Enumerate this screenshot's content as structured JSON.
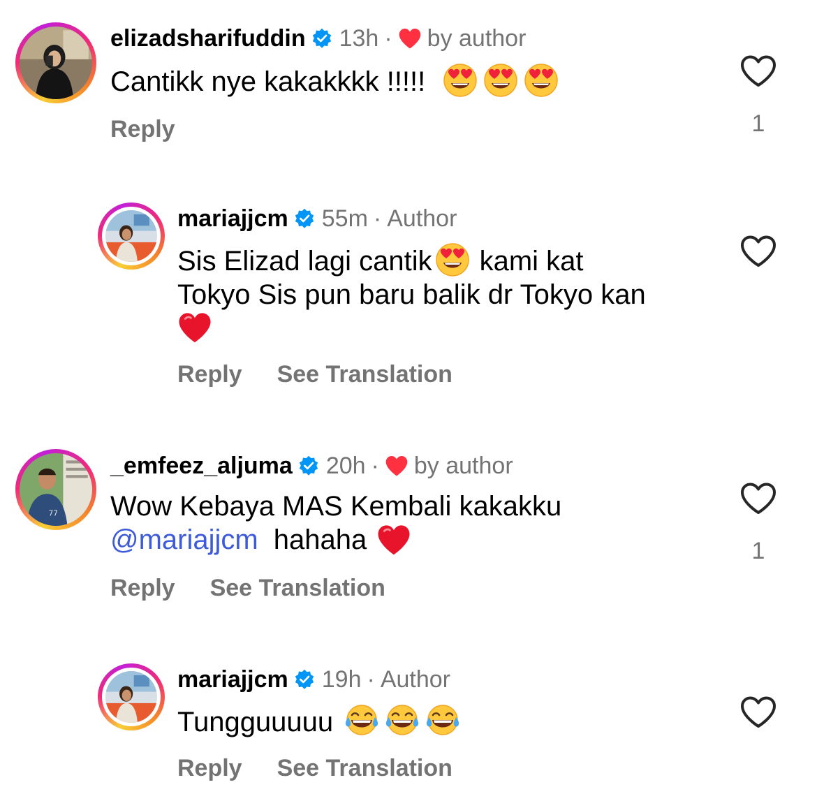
{
  "comments": [
    {
      "username": "elizadsharifuddin",
      "time": "13h",
      "tag": "by author",
      "text": "Cantikk nye kakakkkk !!!!!",
      "reply": "Reply",
      "like_count": "1"
    },
    {
      "username": "mariajjcm",
      "time": "55m",
      "tag": "Author",
      "text_line1": "Sis Elizad lagi cantik",
      "text_line1b": "kami kat",
      "text_line2": "Tokyo Sis pun baru balik dr Tokyo kan",
      "reply": "Reply",
      "translate": "See Translation"
    },
    {
      "username": "_emfeez_aljuma",
      "time": "20h",
      "tag": "by author",
      "text_line1": "Wow Kebaya MAS Kembali kakakku",
      "mention": "@mariajjcm",
      "text_line2b": "hahaha",
      "reply": "Reply",
      "translate": "See Translation",
      "like_count": "1"
    },
    {
      "username": "mariajjcm",
      "time": "19h",
      "tag": "Author",
      "text": "Tungguuuuu",
      "reply": "Reply",
      "translate": "See Translation"
    }
  ],
  "separator": "·",
  "colors": {
    "verified": "#0095f6",
    "heart": "#ff3040",
    "muted": "#737373",
    "mention": "#3d5bd9"
  },
  "icons": [
    "verified-badge-icon",
    "red-heart-icon",
    "heart-eyes-emoji",
    "tears-of-joy-emoji",
    "like-heart-outline-icon"
  ]
}
